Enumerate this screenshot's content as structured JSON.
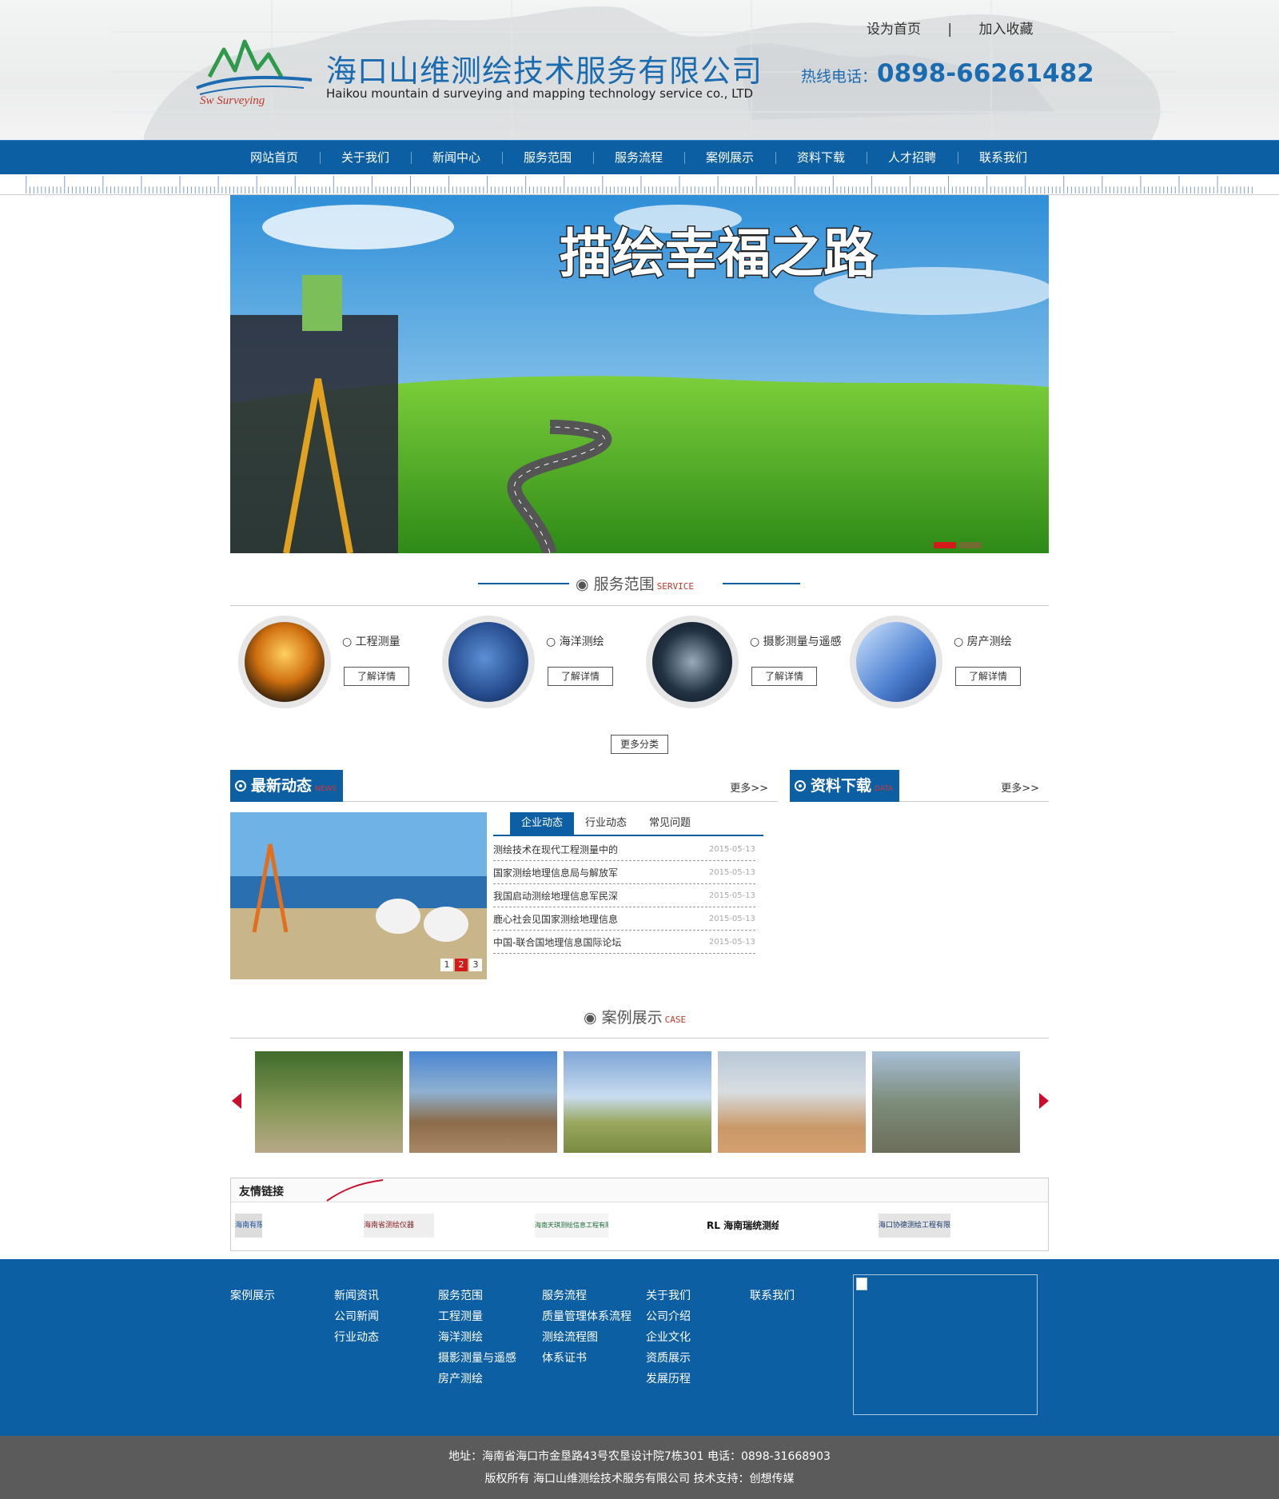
{
  "header": {
    "company_cn": "海口山维测绘技术服务有限公司",
    "company_en": "Haikou mountain d surveying and mapping technology service co., LTD",
    "logo_text": "Sw Surveying",
    "set_home": "设为首页",
    "separator": "|",
    "add_fav": "加入收藏",
    "hotline_label": "热线电话：",
    "hotline_number": "0898-66261482"
  },
  "nav": [
    "网站首页",
    "关于我们",
    "新闻中心",
    "服务范围",
    "服务流程",
    "案例展示",
    "资料下载",
    "人才招聘",
    "联系我们"
  ],
  "banner": {
    "slogan": "描绘幸福之路"
  },
  "services": {
    "title": "服务范围",
    "title_en": "SERVICE",
    "items": [
      {
        "label": "○ 工程测量",
        "button": "了解详情"
      },
      {
        "label": "○ 海洋测绘",
        "button": "了解详情"
      },
      {
        "label": "○ 摄影测量与遥感",
        "button": "了解详情"
      },
      {
        "label": "○ 房产测绘",
        "button": "了解详情"
      }
    ],
    "more": "更多分类"
  },
  "news": {
    "title": "最新动态",
    "title_en": "NEWS",
    "more": "更多>>",
    "pager": [
      "1",
      "2",
      "3"
    ],
    "tabs": [
      "企业动态",
      "行业动态",
      "常见问题"
    ],
    "items": [
      {
        "title": "测绘技术在现代工程测量中的",
        "date": "2015-05-13"
      },
      {
        "title": "国家测绘地理信息局与解放军",
        "date": "2015-05-13"
      },
      {
        "title": "我国启动测绘地理信息军民深",
        "date": "2015-05-13"
      },
      {
        "title": "鹿心社会见国家测绘地理信息",
        "date": "2015-05-13"
      },
      {
        "title": "中国-联合国地理信息国际论坛",
        "date": "2015-05-13"
      }
    ]
  },
  "downloads": {
    "title": "资料下载",
    "title_en": "DATA",
    "more": "更多>>"
  },
  "cases": {
    "title": "案例展示",
    "title_en": "CASE"
  },
  "friend_links": {
    "title": "友情链接",
    "logos": [
      "海南有限公司",
      "海南省测绘仪器",
      "海南天琪测绘信息工程有限公司",
      "RL 海南瑞统测绘",
      "海口协德测绘工程有限公司"
    ]
  },
  "footer": {
    "cols": [
      [
        "案例展示"
      ],
      [
        "新闻资讯",
        "公司新闻",
        "行业动态"
      ],
      [
        "服务范围",
        "工程测量",
        "海洋测绘",
        "摄影测量与遥感",
        "房产测绘"
      ],
      [
        "服务流程",
        "质量管理体系流程",
        "测绘流程图",
        "体系证书"
      ],
      [
        "关于我们",
        "公司介绍",
        "企业文化",
        "资质展示",
        "发展历程"
      ],
      [
        "联系我们"
      ]
    ],
    "address": "地址：海南省海口市金垦路43号农垦设计院7栋301 电话：0898-31668903",
    "copyright": "版权所有 海口山维测绘技术服务有限公司 技术支持：创想传媒"
  },
  "colors": {
    "primary": "#0d5fa3",
    "accent": "#d41b1b",
    "footer_bottom": "#5b5b5b"
  }
}
